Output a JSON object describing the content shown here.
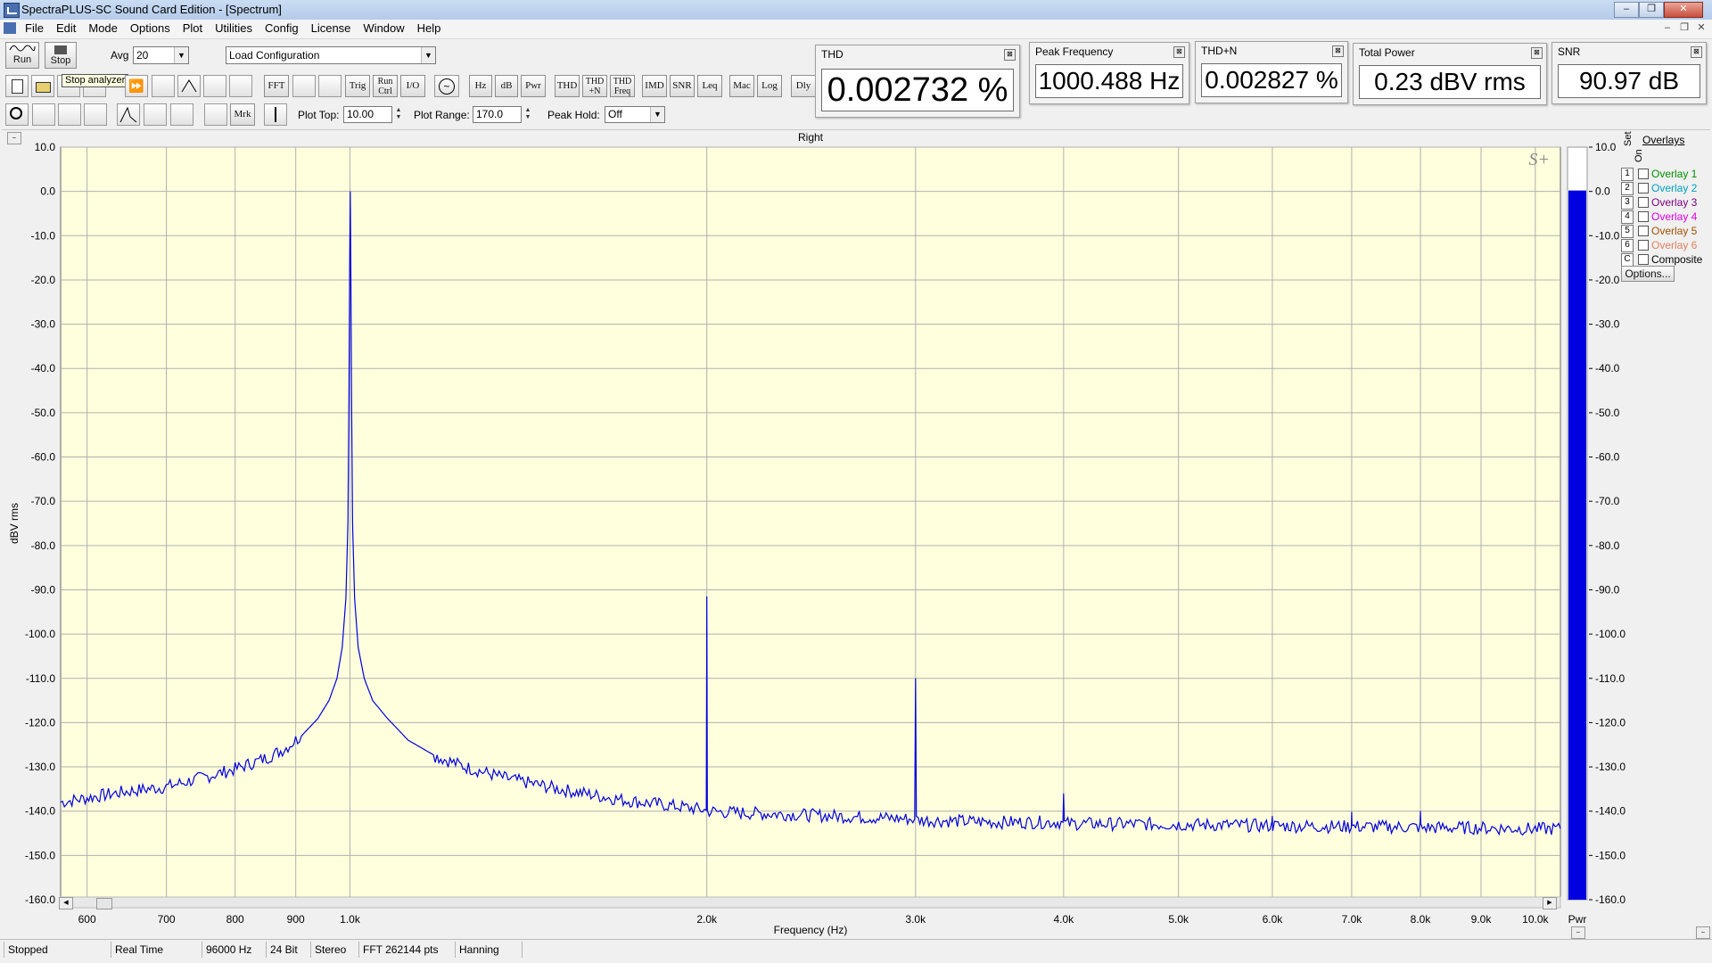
{
  "window": {
    "title": "SpectraPLUS-SC Sound Card Edition - [Spectrum]",
    "buttons": [
      "–",
      "❐",
      "✕"
    ]
  },
  "menu": [
    "File",
    "Edit",
    "Mode",
    "Options",
    "Plot",
    "Utilities",
    "Config",
    "License",
    "Window",
    "Help"
  ],
  "mdi_buttons": [
    "–",
    "❐",
    "✕"
  ],
  "toolbar1": {
    "run_label": "Run",
    "stop_label": "Stop",
    "avg_label": "Avg",
    "avg_value": "20",
    "config_value": "Load Configuration"
  },
  "toolbar2": {
    "tooltip": "Stop analyzer",
    "buttons": [
      "FFT",
      "Trig",
      "Run Ctrl",
      "I/O",
      "Hz",
      "dB",
      "Pwr",
      "THD",
      "THD +N",
      "THD Freq",
      "IMD",
      "SNR",
      "Leq",
      "Mac",
      "Log",
      "Dly"
    ]
  },
  "toolbar3": {
    "buttons": [
      "Mrk"
    ],
    "plot_top_label": "Plot Top:",
    "plot_top_value": "10.00",
    "plot_range_label": "Plot Range:",
    "plot_range_value": "170.0",
    "peak_hold_label": "Peak Hold:",
    "peak_hold_value": "Off"
  },
  "meters": [
    {
      "title": "THD",
      "value": "0.002732 %"
    },
    {
      "title": "Peak Frequency",
      "value": "1000.488 Hz"
    },
    {
      "title": "THD+N",
      "value": "0.002827 %"
    },
    {
      "title": "Total Power",
      "value": "0.23 dBV rms"
    },
    {
      "title": "SNR",
      "value": "90.97 dB"
    }
  ],
  "plot": {
    "channel_title": "Right",
    "logo": "S+",
    "bar_label": "Pwr",
    "bar_value_db": 0.2,
    "colors": {
      "background": "#ffffdd",
      "trace": "#0000e0",
      "grid": "#b0b0b0",
      "bar": "#0000e0"
    }
  },
  "chart_data": {
    "type": "line",
    "title": "Right",
    "xlabel": "Frequency (Hz)",
    "ylabel": "dBV rms",
    "x_scale": "log",
    "xlim": [
      570,
      10500
    ],
    "ylim": [
      -160,
      10
    ],
    "y_ticks": [
      "10.0",
      "0.0",
      "-10.0",
      "-20.0",
      "-30.0",
      "-40.0",
      "-50.0",
      "-60.0",
      "-70.0",
      "-80.0",
      "-90.0",
      "-100.0",
      "-110.0",
      "-120.0",
      "-130.0",
      "-140.0",
      "-150.0",
      "-160.0"
    ],
    "x_ticks": [
      {
        "v": 600,
        "label": "600"
      },
      {
        "v": 700,
        "label": "700"
      },
      {
        "v": 800,
        "label": "800"
      },
      {
        "v": 900,
        "label": "900"
      },
      {
        "v": 1000,
        "label": "1.0k"
      },
      {
        "v": 2000,
        "label": "2.0k"
      },
      {
        "v": 3000,
        "label": "3.0k"
      },
      {
        "v": 4000,
        "label": "4.0k"
      },
      {
        "v": 5000,
        "label": "5.0k"
      },
      {
        "v": 6000,
        "label": "6.0k"
      },
      {
        "v": 7000,
        "label": "7.0k"
      },
      {
        "v": 8000,
        "label": "8.0k"
      },
      {
        "v": 9000,
        "label": "9.0k"
      },
      {
        "v": 10000,
        "label": "10.0k"
      }
    ],
    "grid": true,
    "series": [
      {
        "points": [
          [
            570,
            -138
          ],
          [
            600,
            -137
          ],
          [
            650,
            -135.5
          ],
          [
            700,
            -134.5
          ],
          [
            750,
            -132.5
          ],
          [
            800,
            -130.5
          ],
          [
            850,
            -128
          ],
          [
            880,
            -126
          ],
          [
            910,
            -123
          ],
          [
            940,
            -119
          ],
          [
            960,
            -115
          ],
          [
            975,
            -110
          ],
          [
            985,
            -103
          ],
          [
            992,
            -92
          ],
          [
            996,
            -75
          ],
          [
            998,
            -45
          ],
          [
            999.5,
            -15
          ],
          [
            1000.5,
            0
          ],
          [
            1001.5,
            -15
          ],
          [
            1003,
            -45
          ],
          [
            1005,
            -75
          ],
          [
            1009,
            -92
          ],
          [
            1016,
            -103
          ],
          [
            1028,
            -110
          ],
          [
            1045,
            -115
          ],
          [
            1075,
            -119
          ],
          [
            1120,
            -124
          ],
          [
            1180,
            -127.5
          ],
          [
            1250,
            -130
          ],
          [
            1350,
            -132.5
          ],
          [
            1500,
            -135
          ],
          [
            1700,
            -137.5
          ],
          [
            1900,
            -139
          ],
          [
            1998,
            -139.8
          ],
          [
            2000,
            -91.5
          ],
          [
            2002,
            -140
          ],
          [
            2100,
            -140.3
          ],
          [
            2500,
            -141
          ],
          [
            2995,
            -141.8
          ],
          [
            3000,
            -110
          ],
          [
            3005,
            -142
          ],
          [
            3500,
            -142.5
          ],
          [
            3995,
            -142.5
          ],
          [
            4000,
            -136
          ],
          [
            4005,
            -142.8
          ],
          [
            5000,
            -143
          ],
          [
            5995,
            -143.3
          ],
          [
            6000,
            -140
          ],
          [
            6005,
            -143.3
          ],
          [
            6995,
            -143.5
          ],
          [
            7000,
            -139
          ],
          [
            7005,
            -143.5
          ],
          [
            7995,
            -143.6
          ],
          [
            8000,
            -140
          ],
          [
            8005,
            -143.7
          ],
          [
            9000,
            -143.8
          ],
          [
            10000,
            -144
          ],
          [
            10500,
            -144
          ]
        ]
      }
    ]
  },
  "overlays": {
    "header": "Overlays",
    "col_set": "Set",
    "col_on": "On",
    "items": [
      {
        "num": "1",
        "label": "Overlay 1",
        "color": "#009000"
      },
      {
        "num": "2",
        "label": "Overlay 2",
        "color": "#00a0c0"
      },
      {
        "num": "3",
        "label": "Overlay 3",
        "color": "#800080"
      },
      {
        "num": "4",
        "label": "Overlay 4",
        "color": "#e000e0"
      },
      {
        "num": "5",
        "label": "Overlay 5",
        "color": "#a05000"
      },
      {
        "num": "6",
        "label": "Overlay 6",
        "color": "#e08060"
      },
      {
        "num": "C",
        "label": "Composite",
        "color": "#000000"
      }
    ],
    "options_label": "Options..."
  },
  "status": [
    "Stopped",
    "Real Time",
    "96000 Hz",
    "24 Bit",
    "Stereo",
    "FFT 262144 pts",
    "Hanning"
  ]
}
